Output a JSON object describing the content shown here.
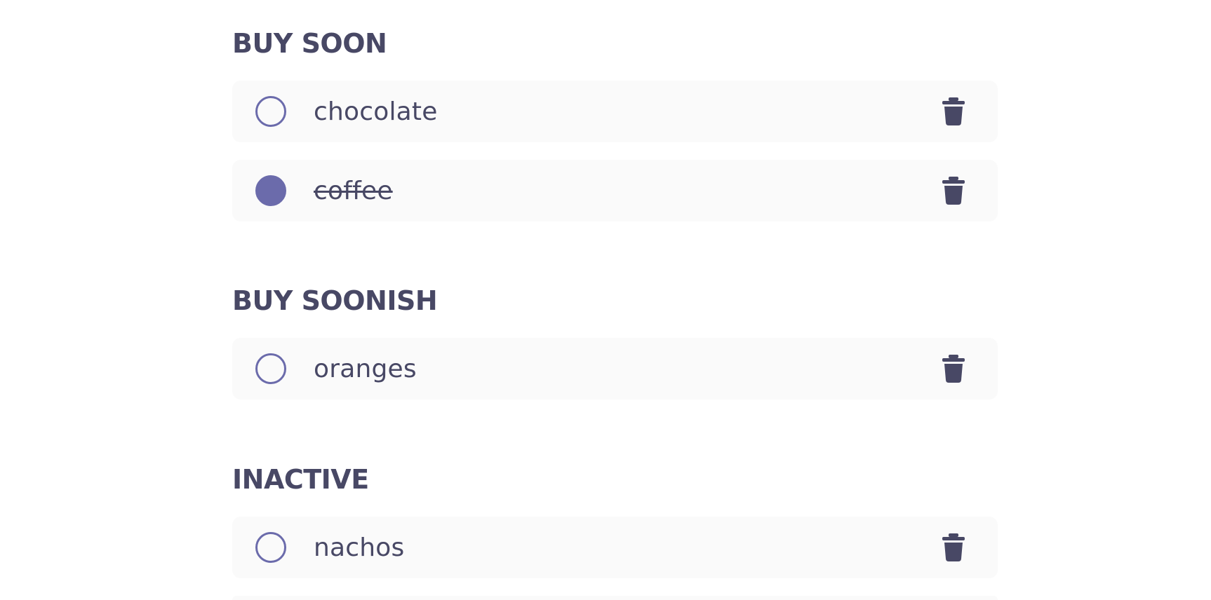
{
  "colors": {
    "text": "#484865",
    "accent": "#6b6bab",
    "row_bg": "#fafafa"
  },
  "sections": [
    {
      "title": "BUY SOON",
      "items": [
        {
          "label": "chocolate",
          "checked": false,
          "icon": "trash-icon"
        },
        {
          "label": "coffee",
          "checked": true,
          "icon": "trash-icon"
        }
      ]
    },
    {
      "title": "BUY SOONISH",
      "items": [
        {
          "label": "oranges",
          "checked": false,
          "icon": "trash-icon"
        }
      ]
    },
    {
      "title": "INACTIVE",
      "items": [
        {
          "label": "nachos",
          "checked": false,
          "icon": "trash-icon"
        }
      ]
    }
  ]
}
